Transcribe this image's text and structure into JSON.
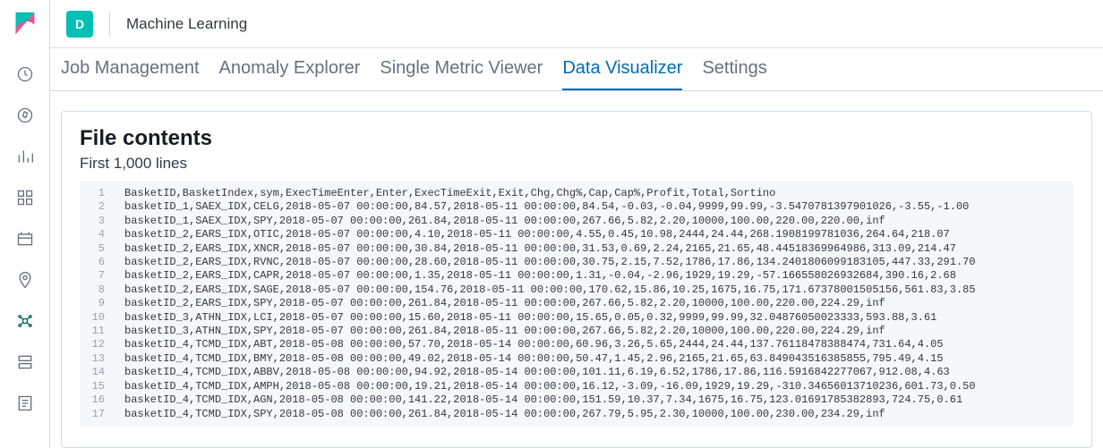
{
  "topbar": {
    "space_letter": "D",
    "app_title": "Machine Learning"
  },
  "tabs": [
    {
      "label": "Job Management",
      "active": false
    },
    {
      "label": "Anomaly Explorer",
      "active": false
    },
    {
      "label": "Single Metric Viewer",
      "active": false
    },
    {
      "label": "Data Visualizer",
      "active": true
    },
    {
      "label": "Settings",
      "active": false
    }
  ],
  "panel": {
    "title": "File contents",
    "subtitle": "First 1,000 lines"
  },
  "file_lines": [
    "BasketID,BasketIndex,sym,ExecTimeEnter,Enter,ExecTimeExit,Exit,Chg,Chg%,Cap,Cap%,Profit,Total,Sortino",
    "basketID_1,SAEX_IDX,CELG,2018-05-07 00:00:00,84.57,2018-05-11 00:00:00,84.54,-0.03,-0.04,9999,99.99,-3.5470781397901026,-3.55,-1.00",
    "basketID_1,SAEX_IDX,SPY,2018-05-07 00:00:00,261.84,2018-05-11 00:00:00,267.66,5.82,2.20,10000,100.00,220.00,220.00,inf",
    "basketID_2,EARS_IDX,OTIC,2018-05-07 00:00:00,4.10,2018-05-11 00:00:00,4.55,0.45,10.98,2444,24.44,268.1908199781036,264.64,218.07",
    "basketID_2,EARS_IDX,XNCR,2018-05-07 00:00:00,30.84,2018-05-11 00:00:00,31.53,0.69,2.24,2165,21.65,48.44518369964986,313.09,214.47",
    "basketID_2,EARS_IDX,RVNC,2018-05-07 00:00:00,28.60,2018-05-11 00:00:00,30.75,2.15,7.52,1786,17.86,134.2401806099183105,447.33,291.70",
    "basketID_2,EARS_IDX,CAPR,2018-05-07 00:00:00,1.35,2018-05-11 00:00:00,1.31,-0.04,-2.96,1929,19.29,-57.166558026932684,390.16,2.68",
    "basketID_2,EARS_IDX,SAGE,2018-05-07 00:00:00,154.76,2018-05-11 00:00:00,170.62,15.86,10.25,1675,16.75,171.67378001505156,561.83,3.85",
    "basketID_2,EARS_IDX,SPY,2018-05-07 00:00:00,261.84,2018-05-11 00:00:00,267.66,5.82,2.20,10000,100.00,220.00,224.29,inf",
    "basketID_3,ATHN_IDX,LCI,2018-05-07 00:00:00,15.60,2018-05-11 00:00:00,15.65,0.05,0.32,9999,99.99,32.04876050023333,593.88,3.61",
    "basketID_3,ATHN_IDX,SPY,2018-05-07 00:00:00,261.84,2018-05-11 00:00:00,267.66,5.82,2.20,10000,100.00,220.00,224.29,inf",
    "basketID_4,TCMD_IDX,ABT,2018-05-08 00:00:00,57.70,2018-05-14 00:00:00,60.96,3.26,5.65,2444,24.44,137.76118478388474,731.64,4.05",
    "basketID_4,TCMD_IDX,BMY,2018-05-08 00:00:00,49.02,2018-05-14 00:00:00,50.47,1.45,2.96,2165,21.65,63.849043516385855,795.49,4.15",
    "basketID_4,TCMD_IDX,ABBV,2018-05-08 00:00:00,94.92,2018-05-14 00:00:00,101.11,6.19,6.52,1786,17.86,116.5916842277067,912.08,4.63",
    "basketID_4,TCMD_IDX,AMPH,2018-05-08 00:00:00,19.21,2018-05-14 00:00:00,16.12,-3.09,-16.09,1929,19.29,-310.34656013710236,601.73,0.50",
    "basketID_4,TCMD_IDX,AGN,2018-05-08 00:00:00,141.22,2018-05-14 00:00:00,151.59,10.37,7.34,1675,16.75,123.01691785382893,724.75,0.61",
    "basketID_4,TCMD_IDX,SPY,2018-05-08 00:00:00,261.84,2018-05-14 00:00:00,267.79,5.95,2.30,10000,100.00,230.00,234.29,inf"
  ]
}
